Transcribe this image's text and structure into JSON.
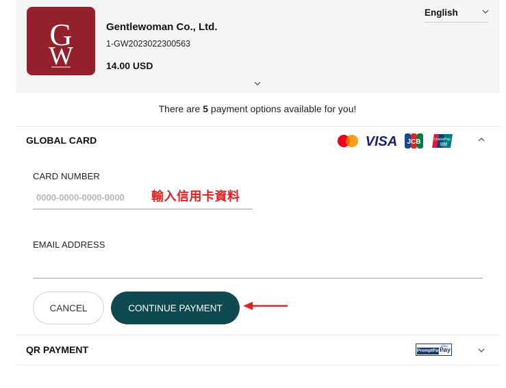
{
  "merchant": {
    "logo_monogram": "GW",
    "name": "Gentlewoman Co., Ltd.",
    "order_id": "1-GW2023022300563",
    "amount": "14.00 USD"
  },
  "language": {
    "selected": "English"
  },
  "notice": {
    "prefix": "There are ",
    "count": "5",
    "suffix": " payment options available for you!"
  },
  "global_card": {
    "title": "GLOBAL CARD",
    "brands": [
      "mastercard-icon",
      "visa-icon",
      "jcb-icon",
      "unionpay-icon"
    ],
    "visa_text": "VISA",
    "jcb_text": "JCB",
    "unionpay_text": "UnionPay",
    "unionpay_cn": "银联",
    "card_number_label": "CARD NUMBER",
    "card_number_placeholder": "0000-0000-0000-0000",
    "card_number_value": "",
    "annotation": "輸入信用卡資料",
    "email_label": "EMAIL ADDRESS",
    "email_value": "",
    "cancel_label": "CANCEL",
    "continue_label": "CONTINUE PAYMENT"
  },
  "qr_payment": {
    "title": "QR PAYMENT",
    "promptpay_top": "พร้อมเพย์",
    "promptpay_left": "PromptPay",
    "promptpay_right": "Pay"
  },
  "colors": {
    "logo_bg": "#93202b",
    "primary_button": "#0f4a52",
    "annotation": "#e02020",
    "header_bg": "#f5f5f5"
  }
}
